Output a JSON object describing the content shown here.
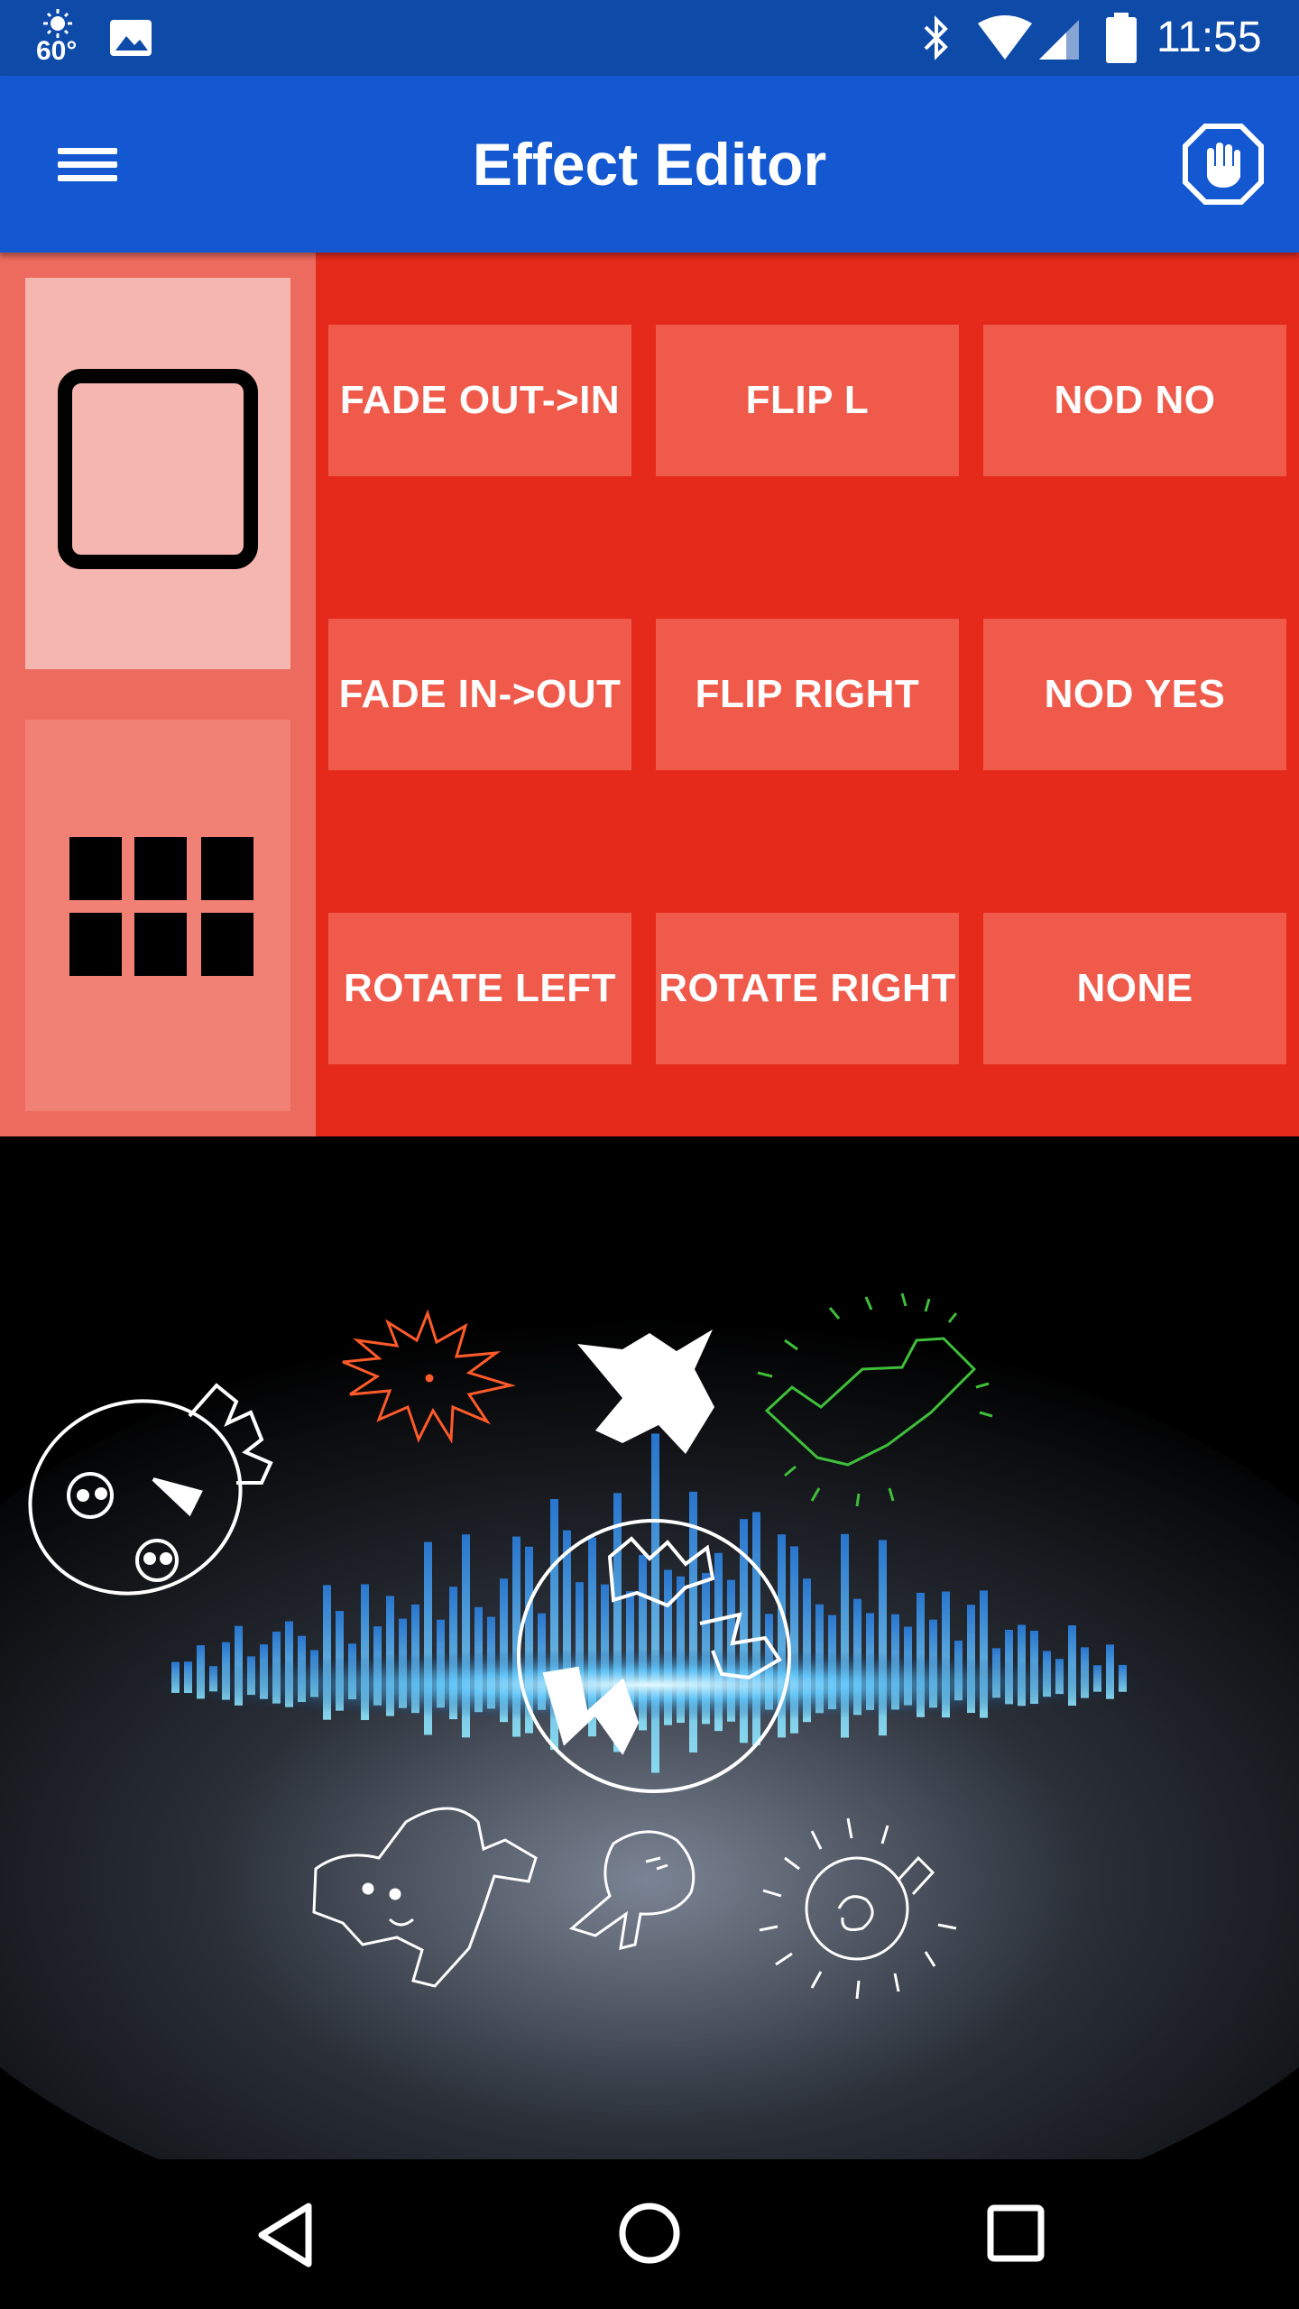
{
  "status_bar": {
    "temperature": "60°",
    "time": "11:55",
    "icons": [
      "weather-sun-icon",
      "image-icon",
      "bluetooth-icon",
      "wifi-icon",
      "signal-icon",
      "battery-icon"
    ]
  },
  "app_bar": {
    "title": "Effect Editor",
    "menu_icon": "hamburger-menu-icon",
    "action_icon": "stop-hand-icon"
  },
  "layout_modes": [
    {
      "id": "single",
      "icon": "single-square-icon",
      "selected": true
    },
    {
      "id": "grid",
      "icon": "grid-six-icon",
      "selected": false
    }
  ],
  "effects": [
    [
      "FADE OUT->IN",
      "FLIP L",
      "NOD NO"
    ],
    [
      "FADE IN->OUT",
      "FLIP RIGHT",
      "NOD YES"
    ],
    [
      "ROTATE LEFT",
      "ROTATE RIGHT",
      "NONE"
    ]
  ],
  "colors": {
    "status_bar": "#0e4ba8",
    "app_bar": "#1358d0",
    "editor_background": "#e52a1c",
    "effect_button": "#ef5a4b",
    "selected_mode": "#f6b6b0"
  },
  "nav_bar": {
    "icons": [
      "back-triangle-icon",
      "home-circle-icon",
      "recents-square-icon"
    ]
  }
}
